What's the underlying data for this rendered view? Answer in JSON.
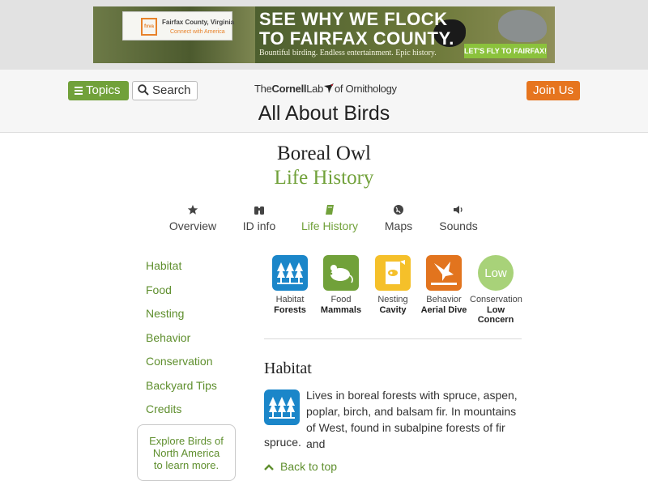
{
  "ad": {
    "org_line1": "Fairfax County, Virginia",
    "org_line2": "Connect with America",
    "logo_text": "fxva",
    "headline1": "SEE WHY WE FLOCK",
    "headline2": "TO FAIRFAX COUNTY.",
    "tagline": "Bountiful birding. Endless entertainment. Epic history.",
    "cta": "LET'S FLY TO FAIRFAX!"
  },
  "header": {
    "topics_label": "Topics",
    "search_label": "Search",
    "lab_the": "The",
    "lab_cornell": "Cornell",
    "lab_lab": "Lab",
    "lab_of": "of Ornithology",
    "site_title": "All About Birds",
    "join_label": "Join Us"
  },
  "species": {
    "name": "Boreal Owl",
    "section": "Life History"
  },
  "tabs": [
    {
      "label": "Overview",
      "icon": "star-icon"
    },
    {
      "label": "ID info",
      "icon": "binoculars-icon"
    },
    {
      "label": "Life History",
      "icon": "book-icon"
    },
    {
      "label": "Maps",
      "icon": "globe-icon"
    },
    {
      "label": "Sounds",
      "icon": "speaker-icon"
    }
  ],
  "sidenav": [
    "Habitat",
    "Food",
    "Nesting",
    "Behavior",
    "Conservation",
    "Backyard Tips",
    "Credits"
  ],
  "explore": {
    "line1": "Explore Birds of",
    "line2": "North America",
    "line3": "to learn more."
  },
  "facts": [
    {
      "caption": "Habitat",
      "value": "Forests",
      "icon": "forest-icon",
      "color": "#1b86c9"
    },
    {
      "caption": "Food",
      "value": "Mammals",
      "icon": "mouse-icon",
      "color": "#71a13a"
    },
    {
      "caption": "Nesting",
      "value": "Cavity",
      "icon": "cavity-icon",
      "color": "#f5c02a"
    },
    {
      "caption": "Behavior",
      "value": "Aerial Dive",
      "icon": "diving-bird-icon",
      "color": "#e2741e"
    },
    {
      "caption": "Conservation",
      "value": "Low",
      "value2": "Concern",
      "badge": "Low",
      "color": "#a8d279"
    }
  ],
  "habitat": {
    "heading": "Habitat",
    "text1": "Lives in boreal forests with spruce, aspen, poplar, birch, and balsam fir. In mountains of West, found in subalpine forests of fir and",
    "text2": "spruce.",
    "back_to_top": "Back to top"
  },
  "colors": {
    "green": "#71a13a",
    "orange": "#e6751f",
    "blue": "#1b86c9"
  }
}
